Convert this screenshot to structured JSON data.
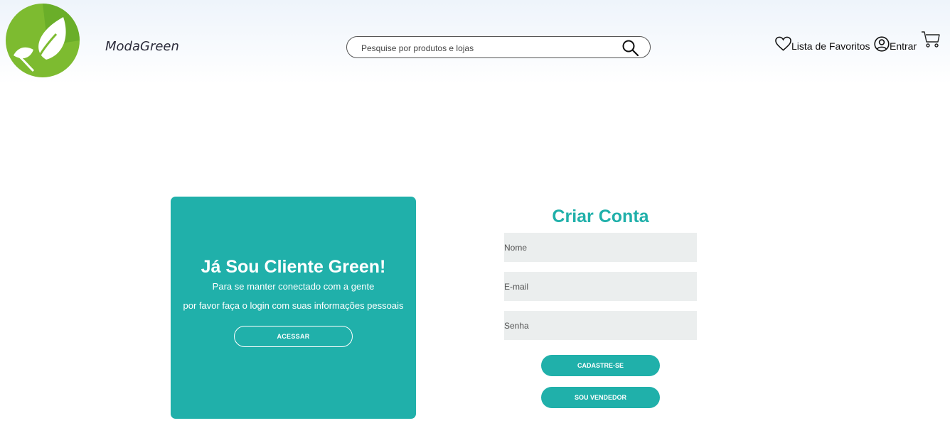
{
  "header": {
    "brand": "ModaGreen",
    "search": {
      "placeholder": "Pesquise por produtos e lojas"
    },
    "favorites_label": "Lista de Favoritos",
    "login_label": "Entrar"
  },
  "login_panel": {
    "title": "Já Sou Cliente Green!",
    "line1": "Para se manter conectado com a gente",
    "line2": "por favor faça o login com suas informações pessoais",
    "button": "ACESSAR"
  },
  "signup": {
    "title": "Criar Conta",
    "name_placeholder": "Nome",
    "email_placeholder": "E-mail",
    "password_placeholder": "Senha",
    "signup_button": "CADASTRE-SE",
    "seller_button": "SOU VENDEDOR"
  },
  "colors": {
    "accent": "#20b0aa",
    "logo_green": "#7dbb30",
    "field_bg": "#ebeeee"
  },
  "icons": [
    "leaf-logo-icon",
    "search-icon",
    "heart-icon",
    "user-icon",
    "cart-icon"
  ]
}
